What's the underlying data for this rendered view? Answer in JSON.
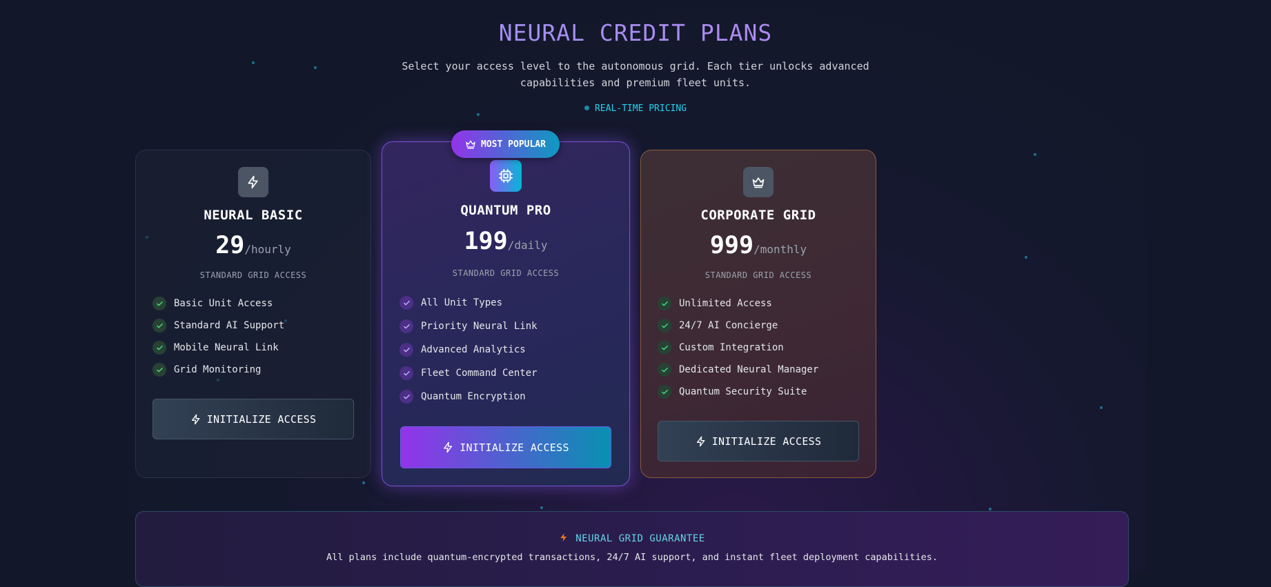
{
  "header": {
    "title": "NEURAL CREDIT PLANS",
    "subtitle": "Select your access level to the autonomous grid. Each tier unlocks advanced capabilities and premium fleet units.",
    "live_label": "REAL-TIME PRICING"
  },
  "badge": {
    "label": "MOST POPULAR",
    "icon": "crown-icon"
  },
  "plans": [
    {
      "name": "NEURAL BASIC",
      "icon": "lightning-icon",
      "price": "29",
      "period": "/hourly",
      "access": "STANDARD GRID ACCESS",
      "features": [
        "Basic Unit Access",
        "Standard AI Support",
        "Mobile Neural Link",
        "Grid Monitoring"
      ],
      "button": "INITIALIZE ACCESS"
    },
    {
      "name": "QUANTUM PRO",
      "icon": "cpu-icon",
      "price": "199",
      "period": "/daily",
      "access": "STANDARD GRID ACCESS",
      "features": [
        "All Unit Types",
        "Priority Neural Link",
        "Advanced Analytics",
        "Fleet Command Center",
        "Quantum Encryption"
      ],
      "button": "INITIALIZE ACCESS"
    },
    {
      "name": "CORPORATE GRID",
      "icon": "crown-icon",
      "price": "999",
      "period": "/monthly",
      "access": "STANDARD GRID ACCESS",
      "features": [
        "Unlimited Access",
        "24/7 AI Concierge",
        "Custom Integration",
        "Dedicated Neural Manager",
        "Quantum Security Suite"
      ],
      "button": "INITIALIZE ACCESS"
    }
  ],
  "guarantee": {
    "title": "NEURAL GRID GUARANTEE",
    "text": "All plans include quantum-encrypted transactions, 24/7 AI support, and instant fleet deployment capabilities."
  },
  "colors": {
    "background": "#121829",
    "accent_purple": "#9333ea",
    "accent_cyan": "#0891b2",
    "check_green": "#4ade80"
  }
}
